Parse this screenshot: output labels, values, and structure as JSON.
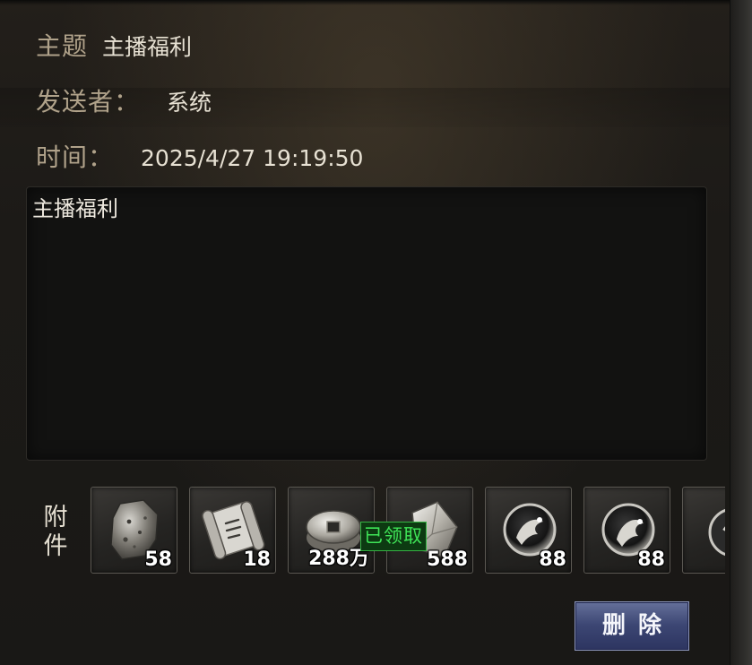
{
  "mail": {
    "subject_label": "主题",
    "subject": "主播福利",
    "sender_label": "发送者：",
    "sender": "系统",
    "time_label": "时间：",
    "time": "2025/4/27 19:19:50",
    "body": "主播福利"
  },
  "attachments": {
    "label_line1": "附",
    "label_line2": "件",
    "claimed_text": "已领取",
    "items": [
      {
        "icon": "ore-stone-icon",
        "quantity": "58"
      },
      {
        "icon": "scroll-icon",
        "quantity": "18"
      },
      {
        "icon": "coin-icon",
        "quantity": "288万"
      },
      {
        "icon": "crystal-shard-icon",
        "quantity": "588"
      },
      {
        "icon": "dragon-orb-icon",
        "quantity": "88"
      },
      {
        "icon": "dragon-orb-icon",
        "quantity": "88"
      },
      {
        "icon": "orb-icon",
        "quantity": ""
      }
    ]
  },
  "actions": {
    "delete_label": "删除"
  }
}
